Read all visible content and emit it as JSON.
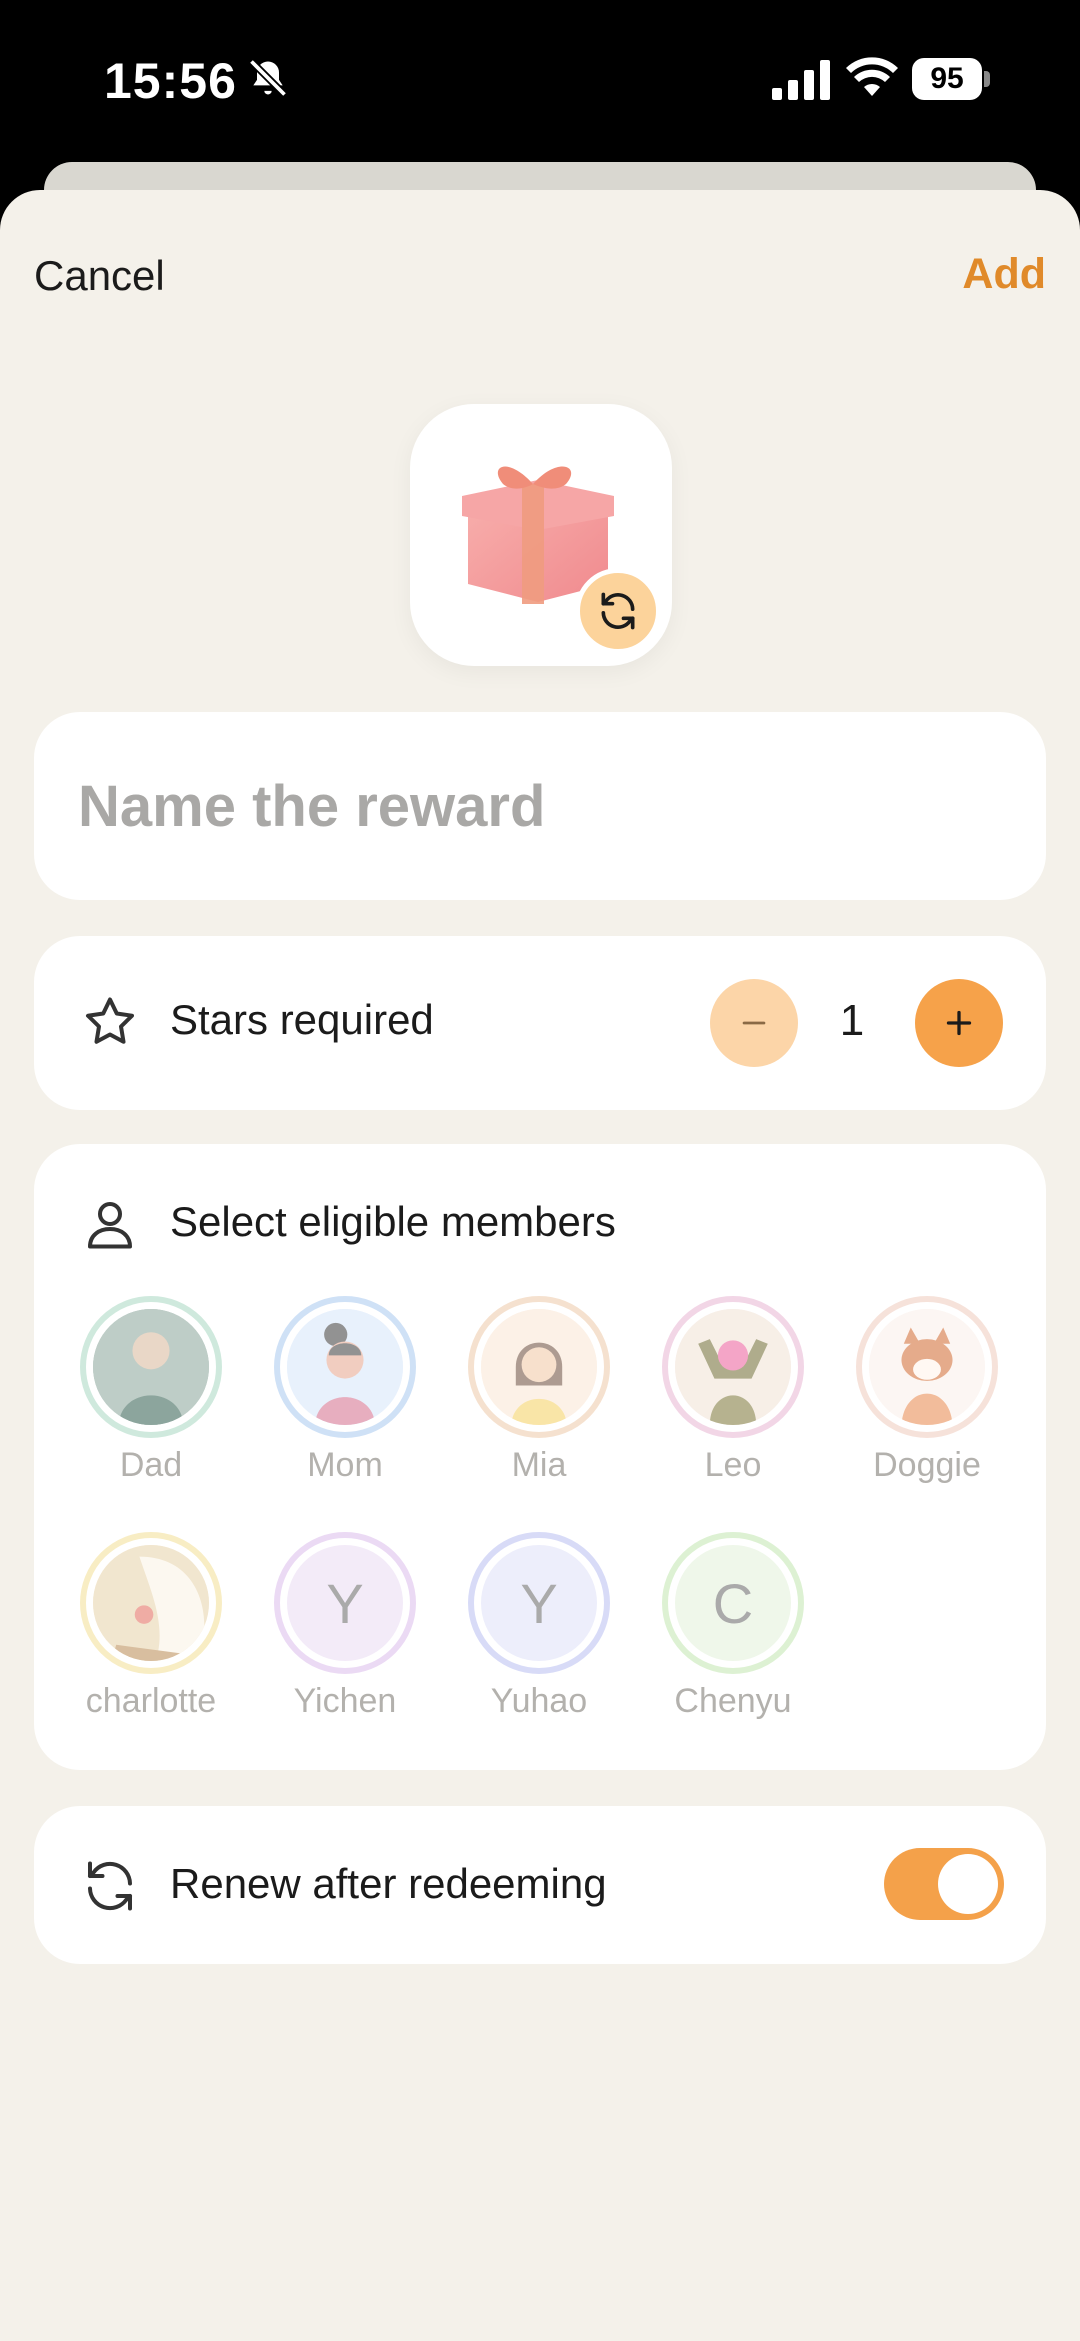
{
  "status_bar": {
    "time": "15:56",
    "battery": "95",
    "icons": [
      "bell-slash-icon",
      "cellular-signal-icon",
      "wifi-icon",
      "battery-icon"
    ]
  },
  "nav": {
    "cancel_label": "Cancel",
    "add_label": "Add"
  },
  "reward_icon": {
    "icon": "gift-icon",
    "badge_icon": "refresh-icon"
  },
  "name_field": {
    "value": "",
    "placeholder": "Name the reward"
  },
  "stars": {
    "label": "Stars required",
    "value": "1",
    "icon": "star-icon"
  },
  "members": {
    "label": "Select eligible members",
    "icon": "person-icon",
    "items": [
      {
        "name": "Dad",
        "initial": "",
        "ring_color": "#a8d8c2"
      },
      {
        "name": "Mom",
        "initial": "",
        "ring_color": "#a9c9ef"
      },
      {
        "name": "Mia",
        "initial": "",
        "ring_color": "#eecaa8"
      },
      {
        "name": "Leo",
        "initial": "",
        "ring_color": "#e9b5d3"
      },
      {
        "name": "Doggie",
        "initial": "",
        "ring_color": "#f0cbbd"
      },
      {
        "name": "charlotte",
        "initial": "",
        "ring_color": "#f3df95"
      },
      {
        "name": "Yichen",
        "initial": "Y",
        "ring_color": "#dcbcec"
      },
      {
        "name": "Yuhao",
        "initial": "Y",
        "ring_color": "#b9bff2"
      },
      {
        "name": "Chenyu",
        "initial": "C",
        "ring_color": "#c3e7b0"
      }
    ]
  },
  "renew": {
    "label": "Renew after redeeming",
    "icon": "refresh-icon",
    "enabled": true
  },
  "colors": {
    "accent": "#f4a14a",
    "accent_text": "#e08a2a",
    "sheet_bg": "#f4f1ea"
  }
}
